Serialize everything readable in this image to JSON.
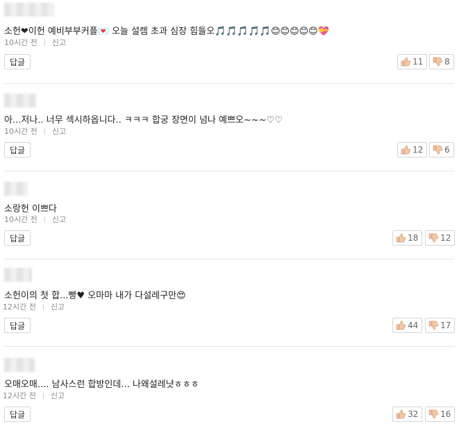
{
  "comments": [
    {
      "text": "소헌❤이헌 예비부부커플💌 오늘 설렘 초과 심장 힘들오🎵🎵🎵🎵🎵😊😊😊😊😊💝",
      "time": "10시간 전",
      "report": "신고",
      "reply": "답글",
      "likes": "11",
      "dislikes": "8"
    },
    {
      "text": "아...저나.. 너무 섹시하옵니다.. ㅋㅋㅋ 합궁 장면이 넘나 예쁘오~~~♡♡",
      "time": "10시간 전",
      "report": "신고",
      "reply": "답글",
      "likes": "12",
      "dislikes": "6"
    },
    {
      "text": "소랑헌 이쁘다",
      "time": "10시간 전",
      "report": "신고",
      "reply": "답글",
      "likes": "18",
      "dislikes": "12"
    },
    {
      "text": "소헌이의 첫 합...빵♥ 오마마 내가 다설레구만😍",
      "time": "12시간 전",
      "report": "신고",
      "reply": "답글",
      "likes": "44",
      "dislikes": "17"
    },
    {
      "text": "오매오매.... 남사스런 합방인데... 나왜설레냣ㅎㅎㅎ",
      "time": "12시간 전",
      "report": "신고",
      "reply": "답글",
      "likes": "32",
      "dislikes": "16"
    }
  ],
  "icons": {
    "like": "thumbs-up-icon",
    "dislike": "thumbs-down-icon"
  },
  "colors": {
    "vote_icon": "#e8b08a",
    "meta_text": "#8a8a8a",
    "divider": "#e6e6e6"
  }
}
